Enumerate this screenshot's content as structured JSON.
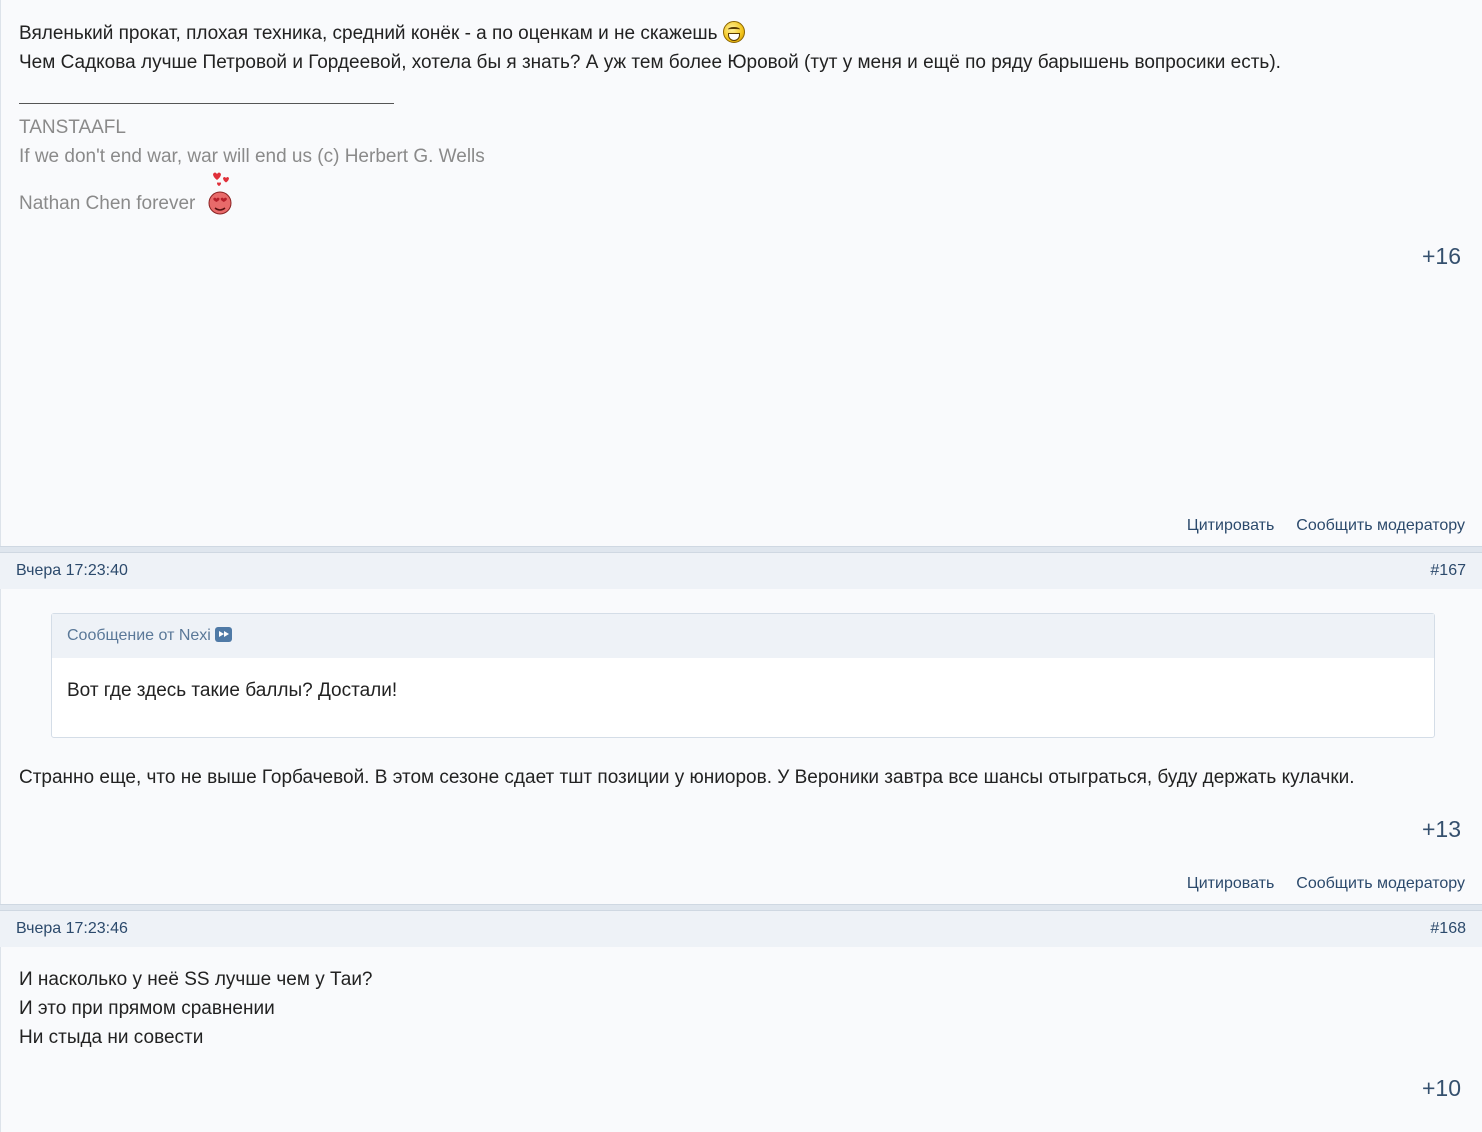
{
  "post166": {
    "lines": [
      "Вяленький прокат, плохая техника, средний конёк - а по оценкам и не скажешь",
      "Чем Садкова лучше Петровой и Гордеевой, хотела бы я знать? А уж тем более Юровой (тут у меня и ещё по ряду барышень вопросики есть)."
    ],
    "signature": {
      "line1": "TANSTAAFL",
      "line2": "If we don't end war, war will end us (c) Herbert G. Wells",
      "line3": "Nathan Chen forever"
    },
    "score": "+16",
    "icons": {
      "laugh": "laughing-smiley-icon",
      "love": "in-love-smiley-icon"
    }
  },
  "actions": {
    "quote": "Цитировать",
    "report": "Сообщить модератору"
  },
  "post167": {
    "date": "Вчера 17:23:40",
    "number": "#167",
    "quote": {
      "author": "Сообщение от Nexi",
      "text": "Вот где здесь такие баллы? Достали!",
      "go_icon": "go-to-post-icon"
    },
    "text": "Странно еще, что не выше Горбачевой. В этом сезоне сдает тшт позиции у юниоров. У Вероники завтра все шансы отыграться, буду держать кулачки.",
    "score": "+13"
  },
  "post168": {
    "date": "Вчера 17:23:46",
    "number": "#168",
    "lines": [
      "И насколько у неё SS лучше чем у Таи?",
      "И это при прямом сравнении",
      "Ни стыда ни совести"
    ],
    "score": "+10"
  },
  "colors": {
    "accent": "#2c4a6c",
    "score": "#35506e",
    "signature": "#8a8a8a",
    "header_bg": "#eef2f7"
  }
}
